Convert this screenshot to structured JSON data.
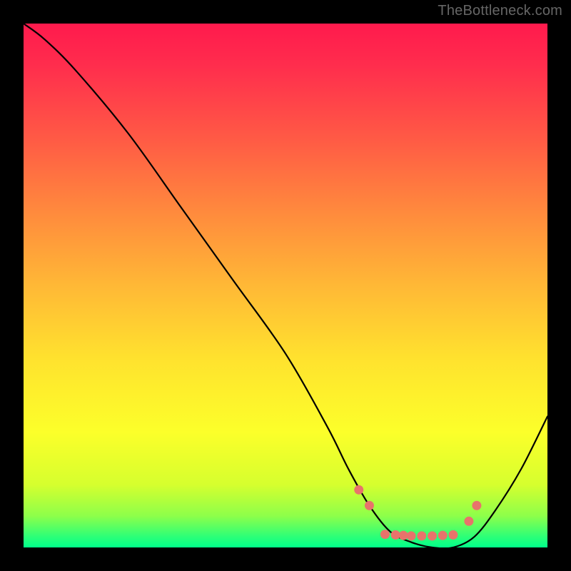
{
  "watermark": "TheBottleneck.com",
  "chart_data": {
    "type": "line",
    "title": "",
    "xlabel": "",
    "ylabel": "",
    "xlim": [
      0,
      100
    ],
    "ylim": [
      0,
      100
    ],
    "series": [
      {
        "name": "bottleneck-curve",
        "x": [
          0,
          4,
          10,
          20,
          30,
          40,
          50,
          58,
          62,
          66,
          70,
          74,
          78,
          82,
          86,
          90,
          95,
          100
        ],
        "y": [
          100,
          97,
          91,
          79,
          65,
          51,
          37,
          23,
          15,
          8,
          3,
          1,
          0,
          0,
          2,
          7,
          15,
          25
        ]
      }
    ],
    "markers": {
      "name": "highlight-dots",
      "color": "#e8736b",
      "points": [
        {
          "x": 64,
          "y": 11
        },
        {
          "x": 66,
          "y": 8
        },
        {
          "x": 69,
          "y": 2.5
        },
        {
          "x": 71,
          "y": 2.4
        },
        {
          "x": 72.5,
          "y": 2.3
        },
        {
          "x": 74,
          "y": 2.2
        },
        {
          "x": 76,
          "y": 2.2
        },
        {
          "x": 78,
          "y": 2.2
        },
        {
          "x": 80,
          "y": 2.3
        },
        {
          "x": 82,
          "y": 2.4
        },
        {
          "x": 85,
          "y": 5
        },
        {
          "x": 86.5,
          "y": 8
        }
      ]
    },
    "gradient_stops": [
      {
        "pos": 0.0,
        "color": "#ff1a4d"
      },
      {
        "pos": 0.5,
        "color": "#ffe22e"
      },
      {
        "pos": 0.95,
        "color": "#8dff4a"
      },
      {
        "pos": 1.0,
        "color": "#00ff8a"
      }
    ]
  }
}
